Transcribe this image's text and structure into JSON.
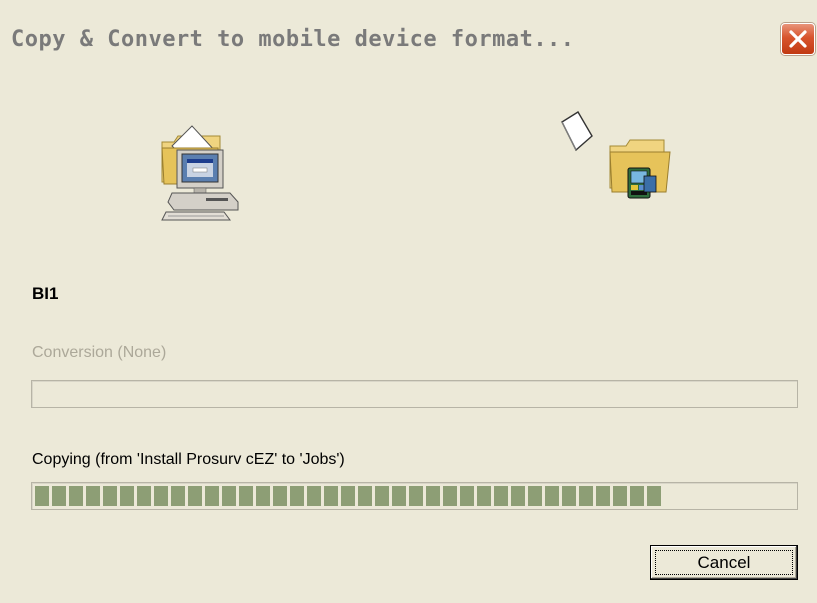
{
  "window": {
    "title": "Copy & Convert to mobile device format...",
    "close_icon": "close-x-icon"
  },
  "icons": {
    "source": "computer-folder-icon",
    "flying": "flying-document-icon",
    "destination": "mobile-device-folder-icon"
  },
  "file": {
    "name": "BI1"
  },
  "conversion": {
    "label": "Conversion (None)",
    "enabled": false,
    "progress": 0
  },
  "copying": {
    "label": "Copying (from 'Install Prosurv cEZ' to 'Jobs')",
    "progress": 0.83
  },
  "buttons": {
    "cancel_label": "Cancel"
  },
  "colors": {
    "progress_fill": "#8d9e75",
    "close_button": "#d8542d",
    "dialog_bg": "#ece9d8"
  }
}
